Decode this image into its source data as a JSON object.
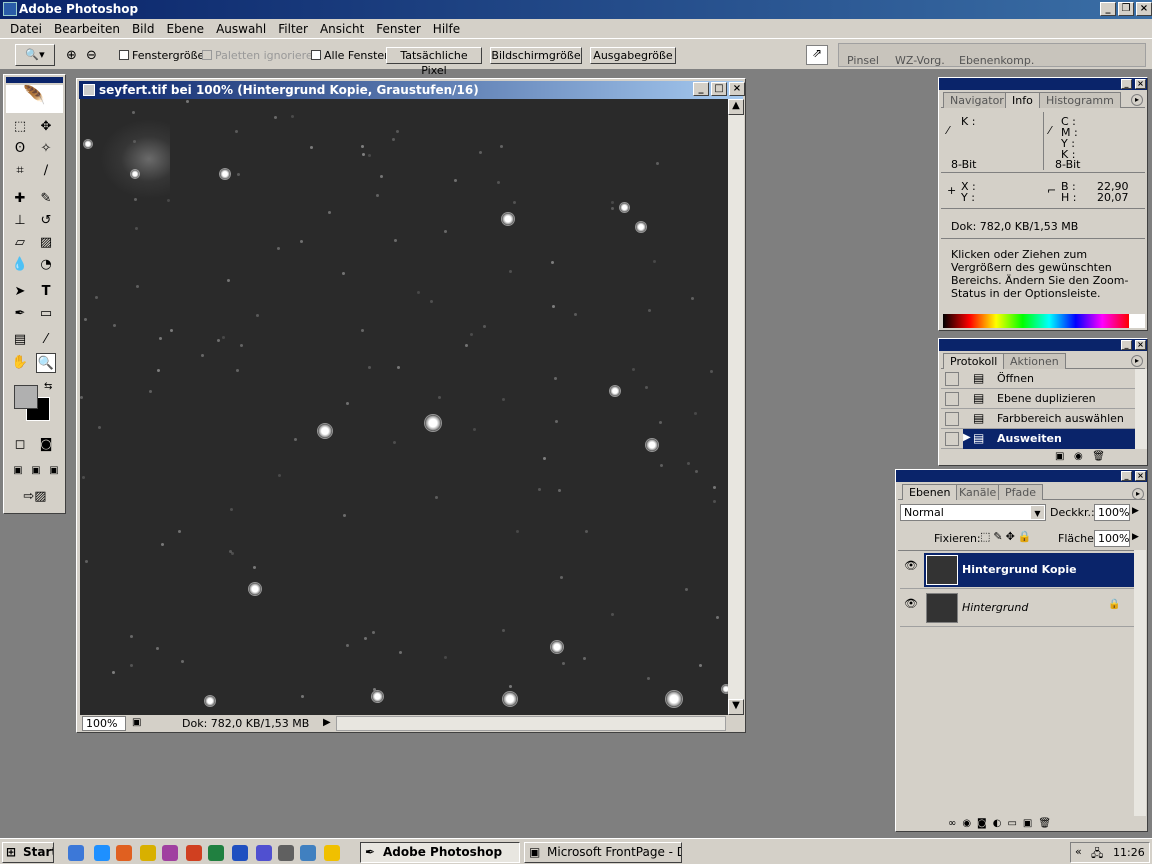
{
  "app": {
    "title": "Adobe Photoshop"
  },
  "menu": [
    "Datei",
    "Bearbeiten",
    "Bild",
    "Ebene",
    "Auswahl",
    "Filter",
    "Ansicht",
    "Fenster",
    "Hilfe"
  ],
  "options": {
    "fenstergroesse": "Fenstergröße",
    "paletten": "Paletten ignorieren",
    "alle_fenster": "Alle Fenster",
    "btn_pixel": "Tatsächliche Pixel",
    "btn_bildschirm": "Bildschirmgröße",
    "btn_ausgabe": "Ausgabegröße",
    "well_tabs": [
      "Pinsel",
      "WZ-Vorg.",
      "Ebenenkomp."
    ]
  },
  "document": {
    "title": "seyfert.tif bei 100% (Hintergrund Kopie, Graustufen/16)",
    "zoom": "100%",
    "status": "Dok: 782,0 KB/1,53 MB"
  },
  "info_panel": {
    "tabs": [
      "Navigator",
      "Info",
      "Histogramm"
    ],
    "k": "K :",
    "c": "C :",
    "m": "M :",
    "y": "Y :",
    "k2": "K :",
    "bit1": "8-Bit",
    "bit2": "8-Bit",
    "x": "X :",
    "y2": "Y :",
    "b": "B :",
    "h": "H :",
    "b_val": "22,90",
    "h_val": "20,07",
    "dok": "Dok: 782,0 KB/1,53 MB",
    "help": "Klicken oder Ziehen zum Vergrößern des gewünschten Bereichs. Ändern Sie den Zoom-Status in der Optionsleiste."
  },
  "history_panel": {
    "tabs": [
      "Protokoll",
      "Aktionen"
    ],
    "items": [
      "Öffnen",
      "Ebene duplizieren",
      "Farbbereich auswählen",
      "Ausweiten"
    ]
  },
  "layers_panel": {
    "tabs": [
      "Ebenen",
      "Kanäle",
      "Pfade"
    ],
    "blend": "Normal",
    "opacity_label": "Deckkr.:",
    "opacity": "100%",
    "lock_label": "Fixieren:",
    "fill_label": "Fläche:",
    "fill": "100%",
    "layers": [
      "Hintergrund Kopie",
      "Hintergrund"
    ]
  },
  "taskbar": {
    "start": "Start",
    "tasks": [
      "Adobe Photoshop",
      "Microsoft FrontPage - D:..."
    ],
    "clock": "11:26"
  }
}
